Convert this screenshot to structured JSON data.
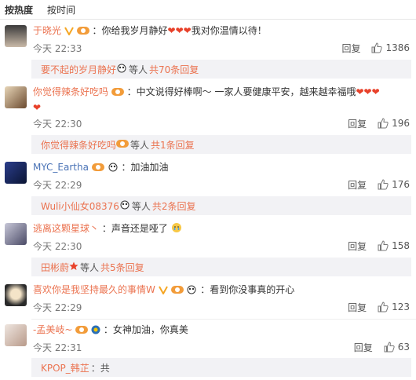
{
  "sort": {
    "hot": "按热度",
    "time": "按时间"
  },
  "common": {
    "reply": "回复",
    "etc": "等人"
  },
  "comments": [
    {
      "user": "于晓光",
      "text": "：你给我岁月静好",
      "hearts": "❤❤❤",
      "text2": "我对你温情以待！",
      "time": "今天 22:33",
      "likes": "1386",
      "sub": {
        "who": "要不起的岁月静好",
        "count": "共70条回复"
      }
    },
    {
      "user": "你觉得辣条好吃吗",
      "text": "：中文说得好棒啊～ 一家人要健康平安，越来越幸福哦",
      "hearts": "❤❤❤❤",
      "time": "今天 22:30",
      "likes": "196",
      "sub": {
        "who": "你觉得辣条好吃吗",
        "count": "共1条回复"
      }
    },
    {
      "user": "MYC_Eartha",
      "text": "：加油加油",
      "time": "今天 22:29",
      "likes": "176",
      "sub": {
        "who": "Wuli小仙女08376",
        "count": "共2条回复"
      }
    },
    {
      "user": "逃离这颗星球丶",
      "text": "：声音还是哑了",
      "time": "今天 22:30",
      "likes": "158",
      "sub": {
        "who": "田彬蔚",
        "count": "共5条回复"
      }
    },
    {
      "user": "喜欢你是我坚持最久的事情W",
      "text": "：看到你没事真的开心",
      "time": "今天 22:29",
      "likes": "123"
    },
    {
      "user": "-孟美岐~",
      "text": "：女神加油，你真美",
      "time": "今天 22:31",
      "likes": "63"
    }
  ],
  "partial_next": {
    "user": "KPOP_韩芷",
    "text": "：共"
  }
}
